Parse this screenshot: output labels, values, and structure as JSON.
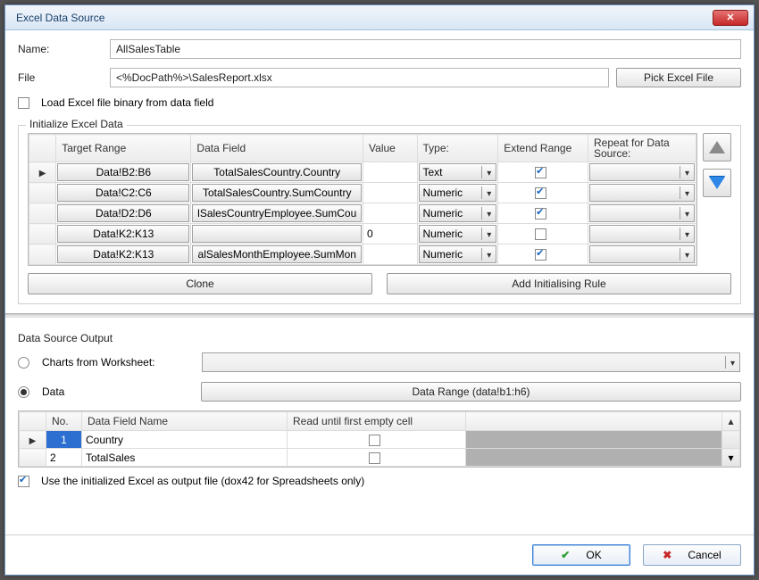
{
  "window": {
    "title": "Excel Data Source"
  },
  "fields": {
    "name_label": "Name:",
    "name_value": "AllSalesTable",
    "file_label": "File",
    "file_value": "<%DocPath%>\\SalesReport.xlsx",
    "pick_file_btn": "Pick Excel File",
    "load_binary_label": "Load Excel file binary from data field"
  },
  "init": {
    "legend": "Initialize Excel Data",
    "headers": {
      "target": "Target Range",
      "datafield": "Data Field",
      "value": "Value",
      "type": "Type:",
      "extend": "Extend Range",
      "repeat": "Repeat for Data Source:"
    },
    "rows": [
      {
        "target": "Data!B2:B6",
        "datafield": "TotalSalesCountry.Country",
        "value": "",
        "type": "Text",
        "extend": true
      },
      {
        "target": "Data!C2:C6",
        "datafield": "TotalSalesCountry.SumCountry",
        "value": "",
        "type": "Numeric",
        "extend": true
      },
      {
        "target": "Data!D2:D6",
        "datafield": "lSalesCountryEmployee.SumCou",
        "value": "",
        "type": "Numeric",
        "extend": true
      },
      {
        "target": "Data!K2:K13",
        "datafield": "",
        "value": "0",
        "type": "Numeric",
        "extend": false
      },
      {
        "target": "Data!K2:K13",
        "datafield": "alSalesMonthEmployee.SumMon",
        "value": "",
        "type": "Numeric",
        "extend": true
      }
    ],
    "clone_btn": "Clone",
    "add_rule_btn": "Add Initialising Rule"
  },
  "output": {
    "legend": "Data Source Output",
    "charts_label": "Charts from Worksheet:",
    "data_label": "Data",
    "data_range_btn": "Data Range (data!b1:h6)",
    "headers": {
      "no": "No.",
      "field": "Data Field Name",
      "readuntil": "Read until first empty cell"
    },
    "rows": [
      {
        "no": "1",
        "field": "Country",
        "readuntil": false
      },
      {
        "no": "2",
        "field": "TotalSales",
        "readuntil": false
      }
    ],
    "use_output_label": "Use the initialized Excel as output file (dox42 for Spreadsheets only)"
  },
  "footer": {
    "ok": "OK",
    "cancel": "Cancel"
  }
}
